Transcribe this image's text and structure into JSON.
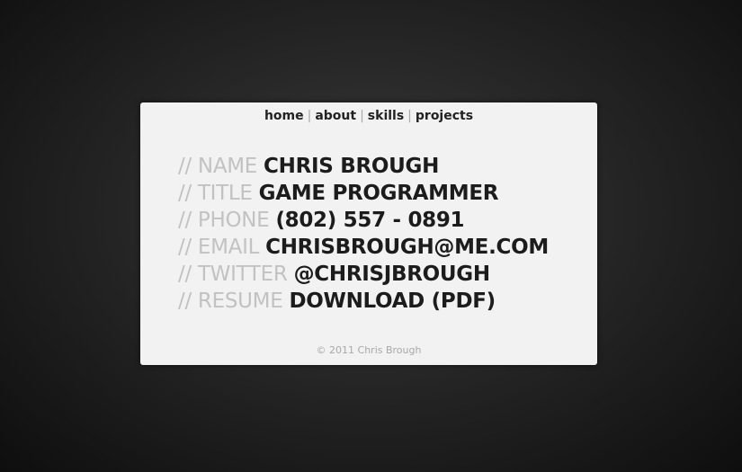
{
  "nav": {
    "items": [
      "home",
      "about",
      "skills",
      "projects"
    ],
    "separator": "|"
  },
  "info": [
    {
      "key": "// NAME",
      "value": "CHRIS BROUGH"
    },
    {
      "key": "// TITLE",
      "value": "GAME PROGRAMMER"
    },
    {
      "key": "// PHONE",
      "value": "(802) 557 - 0891"
    },
    {
      "key": "// EMAIL",
      "value": "CHRISBROUGH@ME.COM"
    },
    {
      "key": "// TWITTER",
      "value": "@CHRISJBROUGH"
    },
    {
      "key": "// RESUME",
      "value": "DOWNLOAD (PDF)"
    }
  ],
  "footer": "© 2011 Chris Brough",
  "colors": {
    "card_bg": "#f2f2f2",
    "key_text": "#c2c2c2",
    "value_text": "#1c1c1c",
    "page_bg": "#262626"
  }
}
